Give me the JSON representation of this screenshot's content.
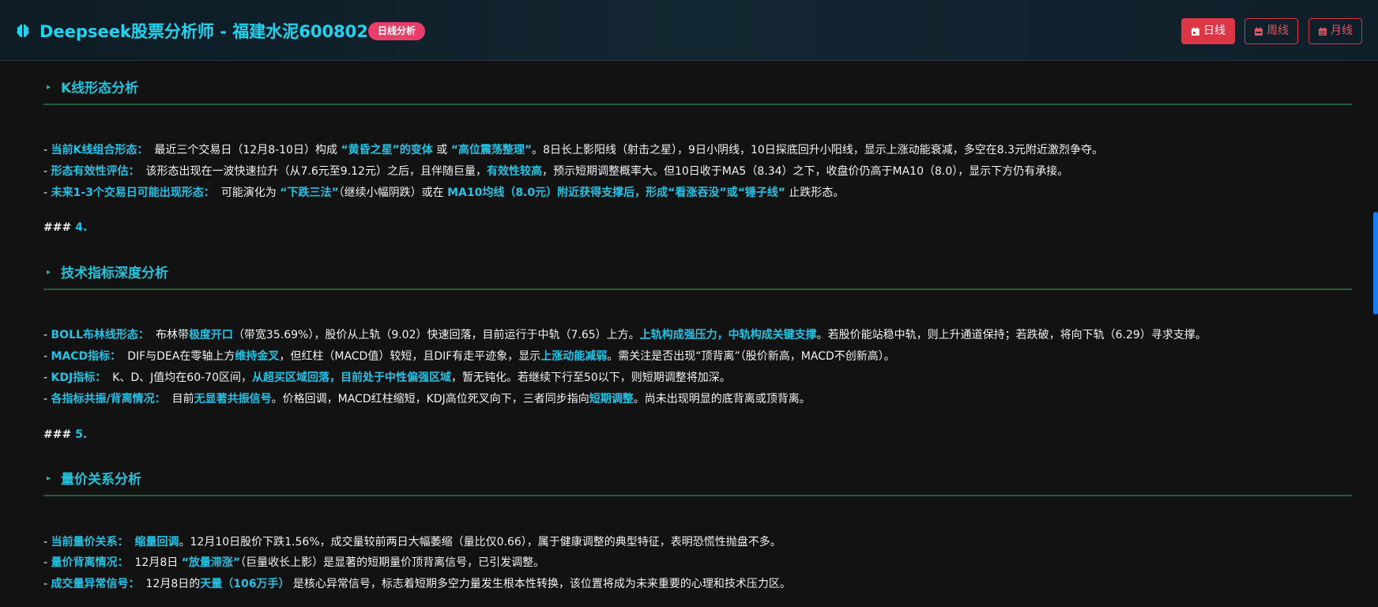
{
  "header": {
    "title": "Deepseek股票分析师 - 福建水泥600802",
    "badge": "日线分析",
    "buttons": [
      {
        "label": "日线",
        "icon": "calendar-day-icon",
        "active": true
      },
      {
        "label": "周线",
        "icon": "calendar-week-icon",
        "active": false
      },
      {
        "label": "月线",
        "icon": "calendar-month-icon",
        "active": false
      }
    ]
  },
  "colors": {
    "accent": "#22c3e6",
    "badge": "#e83e6c",
    "button": "#dc3545",
    "background": "#121212"
  },
  "sections": [
    {
      "title": "K线形态分析",
      "lines": [
        {
          "label": "当前K线组合形态：",
          "parts": [
            "最近三个交易日（12月8-10日）构成 ",
            "“黄昏之星”的变体",
            " 或 ",
            "“高位震荡整理”",
            "。8日长上影阳线（射击之星），9日小阴线，10日探底回升小阳线，显示上涨动能衰减，多空在8.3元附近激烈争夺。"
          ]
        },
        {
          "label": "形态有效性评估：",
          "parts": [
            "该形态出现在一波快速拉升（从7.6元至9.12元）之后，且伴随巨量，",
            "有效性较高",
            "，预示短期调整概率大。但10日收于MA5（8.34）之下，收盘价仍高于MA10（8.0），显示下方仍有承接。"
          ]
        },
        {
          "label": "未来1-3个交易日可能出现形态：",
          "parts": [
            "可能演化为 ",
            "“下跌三法”",
            "（继续小幅阴跌）或在 ",
            "MA10均线（8.0元）附近获得支撑后，形成“看涨吞没”或“锤子线”",
            " 止跌形态。"
          ]
        }
      ],
      "hash": "###",
      "hash_num": "4."
    },
    {
      "title": "技术指标深度分析",
      "lines": [
        {
          "label": "BOLL布林线形态：",
          "parts": [
            "布林带",
            "极度开口",
            "（带宽35.69%），股价从上轨（9.02）快速回落，目前运行于中轨（7.65）上方。",
            "上轨构成强压力，中轨构成关键支撑",
            "。若股价能站稳中轨，则上升通道保持；若跌破，将向下轨（6.29）寻求支撑。"
          ]
        },
        {
          "label": "MACD指标：",
          "parts": [
            "DIF与DEA在零轴上方",
            "维持金叉",
            "，但红柱（MACD值）较短，且DIF有走平迹象，显示",
            "上涨动能减弱",
            "。需关注是否出现“顶背离”（股价新高，MACD不创新高）。"
          ]
        },
        {
          "label": "KDJ指标：",
          "parts": [
            "K、D、J值均在60-70区间，",
            "从超买区域回落，目前处于中性偏强区域",
            "，暂无钝化。若继续下行至50以下，则短期调整将加深。"
          ]
        },
        {
          "label": "各指标共振/背离情况：",
          "parts": [
            "目前",
            "无显著共振信号",
            "。价格回调，MACD红柱缩短，KDJ高位死叉向下，三者同步指向",
            "短期调整",
            "。尚未出现明显的底背离或顶背离。"
          ]
        }
      ],
      "hash": "###",
      "hash_num": "5."
    },
    {
      "title": "量价关系分析",
      "lines": [
        {
          "label": "当前量价关系：",
          "parts": [
            "",
            "缩量回调",
            "。12月10日股价下跌1.56%，成交量较前两日大幅萎缩（量比仅0.66），属于健康调整的典型特征，表明恐慌性抛盘不多。"
          ]
        },
        {
          "label": "量价背离情况：",
          "parts": [
            "12月8日 ",
            "“放量滞涨”",
            "（巨量收长上影）是显著的短期量价顶背离信号，已引发调整。"
          ]
        },
        {
          "label": "成交量异常信号：",
          "parts": [
            "12月8日的",
            "天量（106万手）",
            " 是核心异常信号，标志着短期多空力量发生根本性转换，该位置将成为未来重要的心理和技术压力区。"
          ]
        }
      ]
    }
  ]
}
